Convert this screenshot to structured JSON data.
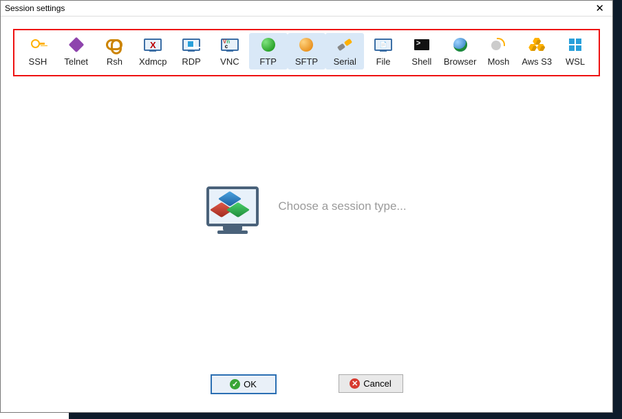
{
  "window": {
    "title": "Session settings"
  },
  "tabs": [
    {
      "id": "ssh",
      "label": "SSH",
      "highlighted": false
    },
    {
      "id": "telnet",
      "label": "Telnet",
      "highlighted": false
    },
    {
      "id": "rsh",
      "label": "Rsh",
      "highlighted": false
    },
    {
      "id": "xdmcp",
      "label": "Xdmcp",
      "highlighted": false
    },
    {
      "id": "rdp",
      "label": "RDP",
      "highlighted": false
    },
    {
      "id": "vnc",
      "label": "VNC",
      "highlighted": false
    },
    {
      "id": "ftp",
      "label": "FTP",
      "highlighted": true
    },
    {
      "id": "sftp",
      "label": "SFTP",
      "highlighted": true
    },
    {
      "id": "serial",
      "label": "Serial",
      "highlighted": true
    },
    {
      "id": "file",
      "label": "File",
      "highlighted": false
    },
    {
      "id": "shell",
      "label": "Shell",
      "highlighted": false
    },
    {
      "id": "browser",
      "label": "Browser",
      "highlighted": false
    },
    {
      "id": "mosh",
      "label": "Mosh",
      "highlighted": false
    },
    {
      "id": "awss3",
      "label": "Aws S3",
      "highlighted": false
    },
    {
      "id": "wsl",
      "label": "WSL",
      "highlighted": false
    }
  ],
  "main": {
    "prompt": "Choose a session type..."
  },
  "buttons": {
    "ok": "OK",
    "cancel": "Cancel"
  },
  "icons": {
    "ssh": "key-icon",
    "telnet": "gem-icon",
    "rsh": "knot-icon",
    "xdmcp": "xserver-icon",
    "rdp": "windows-monitor-icon",
    "vnc": "vnc-monitor-icon",
    "ftp": "green-globe-icon",
    "sftp": "orange-globe-icon",
    "serial": "serial-cable-icon",
    "file": "file-monitor-icon",
    "shell": "terminal-icon",
    "browser": "browser-globe-icon",
    "mosh": "satellite-dish-icon",
    "awss3": "hex-cluster-icon",
    "wsl": "windows-logo-icon"
  }
}
